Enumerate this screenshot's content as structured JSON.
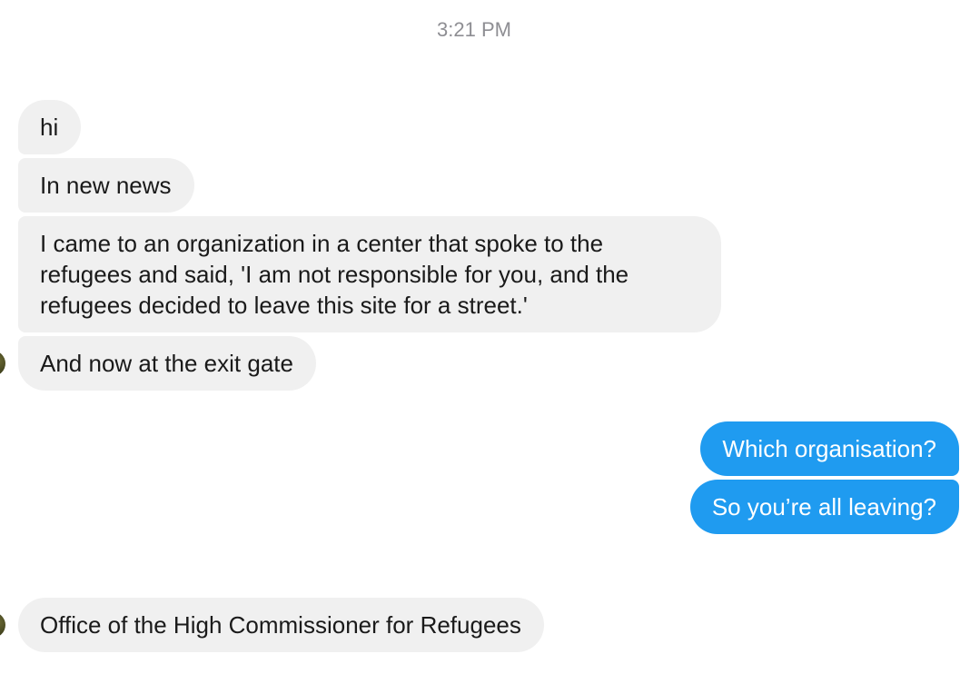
{
  "thread": {
    "timestamp": "3:21 PM",
    "messages": [
      {
        "sender": "them",
        "text": "hi"
      },
      {
        "sender": "them",
        "text": "In new news"
      },
      {
        "sender": "them",
        "lines": [
          "I came to an organization in a center that spoke to the",
          "refugees and said, 'I am not responsible for you, and the",
          "refugees decided to leave this site for a street.'"
        ]
      },
      {
        "sender": "them",
        "text": "And now at the exit gate"
      },
      {
        "sender": "me",
        "text": "Which organisation?"
      },
      {
        "sender": "me",
        "text": "So you’re all leaving?"
      },
      {
        "sender": "them",
        "text": "Office of the High Commissioner for Refugees"
      }
    ]
  },
  "colors": {
    "incoming_bubble": "#f0f0f0",
    "outgoing_bubble": "#1f9bf0",
    "timestamp_text": "#8e8e93"
  }
}
